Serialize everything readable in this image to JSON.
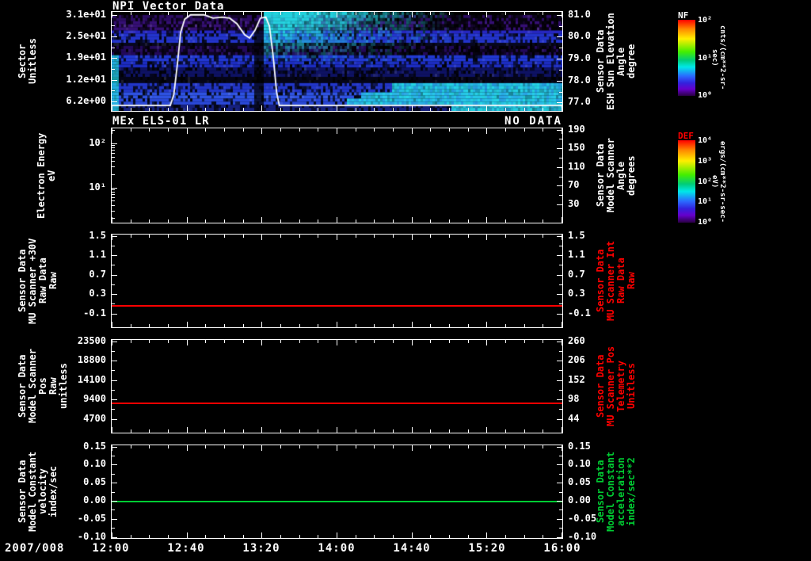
{
  "x_axis": {
    "date_label": "2007/008",
    "tick_labels": [
      "12:00",
      "12:40",
      "13:20",
      "14:00",
      "14:40",
      "15:20",
      "16:00"
    ]
  },
  "chart_data": [
    {
      "id": "npi-vector-data",
      "type": "heatmap",
      "title": "NPI Vector Data",
      "left_axis": {
        "label": "Sector\nUnitless",
        "ticks": [
          {
            "label": "3.1e+01",
            "f": 0.03
          },
          {
            "label": "2.5e+01",
            "f": 0.25
          },
          {
            "label": "1.9e+01",
            "f": 0.47
          },
          {
            "label": "1.2e+01",
            "f": 0.69
          },
          {
            "label": "6.2e+00",
            "f": 0.91
          }
        ]
      },
      "right_axis": {
        "label": "Sensor Data\nESH Sun Elevation\nAngle\ndegree",
        "ticks": [
          {
            "label": "81.0",
            "f": 0.03
          },
          {
            "label": "80.0",
            "f": 0.253
          },
          {
            "label": "79.0",
            "f": 0.477
          },
          {
            "label": "78.0",
            "f": 0.7
          },
          {
            "label": "77.0",
            "f": 0.923
          }
        ]
      },
      "colorbar": {
        "title": "NF",
        "unit": "cnts/(cm**2-sr-sec)",
        "ticks": [
          "10²",
          "10¹",
          "10⁰"
        ]
      },
      "overlay_line": {
        "name": "ESH Sun Elevation Angle",
        "color": "#ffffff",
        "axis": "right",
        "points_t_deg": [
          [
            0,
            76.9
          ],
          [
            0.13,
            76.9
          ],
          [
            0.138,
            77.4
          ],
          [
            0.146,
            78.8
          ],
          [
            0.153,
            80.2
          ],
          [
            0.162,
            80.8
          ],
          [
            0.175,
            81
          ],
          [
            0.205,
            81
          ],
          [
            0.225,
            80.85
          ],
          [
            0.245,
            80.9
          ],
          [
            0.262,
            80.85
          ],
          [
            0.278,
            80.6
          ],
          [
            0.295,
            80.1
          ],
          [
            0.306,
            79.95
          ],
          [
            0.318,
            80.3
          ],
          [
            0.33,
            80.85
          ],
          [
            0.342,
            80.9
          ],
          [
            0.35,
            80.5
          ],
          [
            0.358,
            79.2
          ],
          [
            0.366,
            77.5
          ],
          [
            0.372,
            76.9
          ],
          [
            1,
            76.9
          ]
        ]
      },
      "heatmap_bands": [
        {
          "y0": 0,
          "y1": 0.035,
          "base": "#000000",
          "noise": 0
        },
        {
          "y0": 0.035,
          "y1": 0.1,
          "base": "#2c0c62",
          "noise": 0.5,
          "sparse_right": true
        },
        {
          "y0": 0.1,
          "y1": 0.175,
          "base": "#350f74",
          "noise": 0.5,
          "sparse_right": true
        },
        {
          "y0": 0.175,
          "y1": 0.215,
          "base": "#2626c0",
          "noise": 0.3
        },
        {
          "y0": 0.215,
          "y1": 0.3,
          "base": "#2334cc",
          "noise": 0.3
        },
        {
          "y0": 0.3,
          "y1": 0.345,
          "base": "#07071e",
          "noise": 0.2
        },
        {
          "y0": 0.345,
          "y1": 0.425,
          "base": "#23095a",
          "noise": 0.5,
          "sparse_right": true
        },
        {
          "y0": 0.425,
          "y1": 0.5,
          "base": "#2138d2",
          "noise": 0.3
        },
        {
          "y0": 0.5,
          "y1": 0.565,
          "base": "#1c2cc0",
          "noise": 0.3
        },
        {
          "y0": 0.565,
          "y1": 0.645,
          "base": "#0e1264",
          "noise": 0.35
        },
        {
          "y0": 0.645,
          "y1": 0.72,
          "base": "#050518",
          "noise": 0.2
        },
        {
          "y0": 0.72,
          "y1": 0.8,
          "base": "#2236c8",
          "noise": 0.3,
          "cyan_from": 0.62
        },
        {
          "y0": 0.8,
          "y1": 0.885,
          "base": "#2e52e2",
          "noise": 0.25,
          "cyan_from": 0.55
        },
        {
          "y0": 0.885,
          "y1": 0.945,
          "base": "#2a48d8",
          "noise": 0.25,
          "cyan_from": 0.52
        },
        {
          "y0": 0.945,
          "y1": 1,
          "base": "#16207e",
          "noise": 0.35,
          "cyan_from": 0.75
        }
      ]
    },
    {
      "id": "mex-els-01-lr",
      "type": "heatmap",
      "title": "MEx ELS-01 LR",
      "status": "NO DATA",
      "empty": true,
      "left_axis": {
        "label": "Electron Energy\neV",
        "scale": "log",
        "ticks": [
          {
            "label": "10²",
            "f": 0.158
          },
          {
            "label": "10¹",
            "f": 0.633
          }
        ],
        "minor_fracs": [
          0.015,
          0.176,
          0.202,
          0.231,
          0.263,
          0.301,
          0.347,
          0.406,
          0.49,
          0.655,
          0.679,
          0.706,
          0.738,
          0.775,
          0.82,
          0.878,
          0.96
        ]
      },
      "right_axis": {
        "label": "Sensor Data\nModel Scanner\nAngle\ndegrees",
        "ticks": [
          {
            "label": "190",
            "f": 0.013
          },
          {
            "label": "150",
            "f": 0.213
          },
          {
            "label": "110",
            "f": 0.413
          },
          {
            "label": "70",
            "f": 0.613
          },
          {
            "label": "30",
            "f": 0.813
          }
        ]
      },
      "colorbar": {
        "title": "DEF",
        "unit": "ergs/(cm**2-sr-sec-eV)",
        "ticks": [
          "10⁴",
          "10³",
          "10²",
          "10¹",
          "10⁰"
        ]
      }
    },
    {
      "id": "mu-scanner-raw",
      "type": "line",
      "left_axis": {
        "label": "Sensor Data\nMU Scanner +30V\nRaw Data\nRaw",
        "ticks": [
          {
            "label": "1.5",
            "f": 0.013
          },
          {
            "label": "1.1",
            "f": 0.225
          },
          {
            "label": "0.7",
            "f": 0.437
          },
          {
            "label": "0.3",
            "f": 0.648
          },
          {
            "label": "-0.1",
            "f": 0.86
          }
        ]
      },
      "right_axis": {
        "label": "Sensor Data\nMU Scanner Int\nRaw Data\nRaw",
        "label_color": "#ff0000",
        "ticks": [
          {
            "label": "1.5",
            "f": 0.013
          },
          {
            "label": "1.1",
            "f": 0.225
          },
          {
            "label": "0.7",
            "f": 0.437
          },
          {
            "label": "0.3",
            "f": 0.648
          },
          {
            "label": "-0.1",
            "f": 0.86
          }
        ]
      },
      "series": [
        {
          "name": "MU Scanner +30V Raw",
          "color": "#ff0000",
          "constant_value": 0.05,
          "f": 0.77
        }
      ]
    },
    {
      "id": "model-scanner-pos",
      "type": "line",
      "left_axis": {
        "label": "Sensor Data\nModel Scanner Pos\nRaw\nunitless",
        "ticks": [
          {
            "label": "23500",
            "f": 0.013
          },
          {
            "label": "18800",
            "f": 0.225
          },
          {
            "label": "14100",
            "f": 0.437
          },
          {
            "label": "9400",
            "f": 0.648
          },
          {
            "label": "4700",
            "f": 0.86
          }
        ]
      },
      "right_axis": {
        "label": "Sensor Data\nMU Scanner Pos\nTelemetry\nUnitless",
        "label_color": "#ff0000",
        "ticks": [
          {
            "label": "260",
            "f": 0.013
          },
          {
            "label": "206",
            "f": 0.225
          },
          {
            "label": "152",
            "f": 0.437
          },
          {
            "label": "98",
            "f": 0.648
          },
          {
            "label": "44",
            "f": 0.86
          }
        ]
      },
      "series": [
        {
          "name": "Model Scanner Pos Raw",
          "color": "#ff0000",
          "constant_value": 8700,
          "f": 0.68
        }
      ]
    },
    {
      "id": "model-constant",
      "type": "line",
      "left_axis": {
        "label": "Sensor Data\nModel Constant\nvelocity\nindex/sec",
        "ticks": [
          {
            "label": "0.15",
            "f": 0.013
          },
          {
            "label": "0.10",
            "f": 0.21
          },
          {
            "label": "0.05",
            "f": 0.407
          },
          {
            "label": "0.00",
            "f": 0.604
          },
          {
            "label": "-0.05",
            "f": 0.801
          },
          {
            "label": "-0.10",
            "f": 0.998
          }
        ]
      },
      "right_axis": {
        "label": "Sensor Data\nModel Constant\nacceleration\nindex/sec**2",
        "label_color": "#00cc33",
        "ticks": [
          {
            "label": "0.15",
            "f": 0.013
          },
          {
            "label": "0.10",
            "f": 0.21
          },
          {
            "label": "0.05",
            "f": 0.407
          },
          {
            "label": "0.00",
            "f": 0.604
          },
          {
            "label": "-0.05",
            "f": 0.801
          },
          {
            "label": "-0.10",
            "f": 0.998
          }
        ]
      },
      "series": [
        {
          "name": "Model Constant velocity",
          "color": "#00cc33",
          "constant_value": 0,
          "f": 0.604
        }
      ]
    }
  ]
}
